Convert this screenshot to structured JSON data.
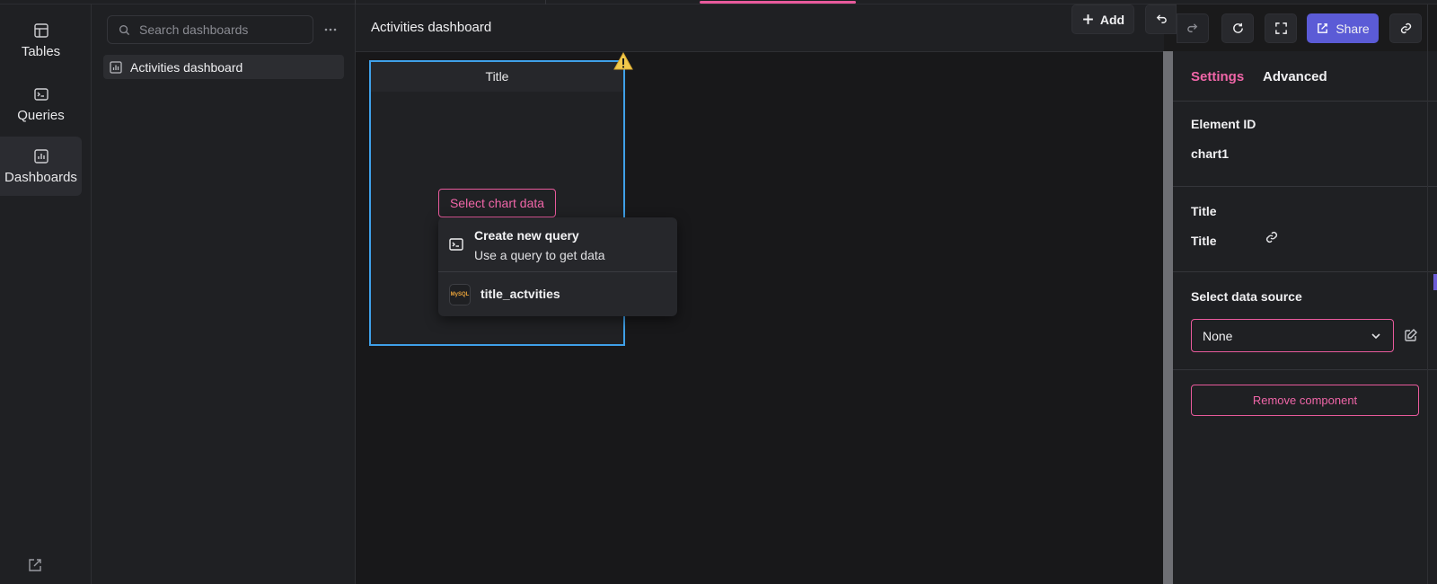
{
  "colors": {
    "accent_pink": "#e85a9c",
    "selection_blue": "#3fa0e8",
    "share_purple": "#5b5bd6",
    "warning_yellow": "#f2c94c"
  },
  "rail": {
    "items": [
      {
        "label": "Tables",
        "icon": "table-icon"
      },
      {
        "label": "Queries",
        "icon": "terminal-icon"
      },
      {
        "label": "Dashboards",
        "icon": "chart-icon"
      }
    ]
  },
  "dashboards_panel": {
    "search_placeholder": "Search dashboards",
    "items": [
      {
        "label": "Activities dashboard"
      }
    ]
  },
  "toolbar": {
    "title": "Activities dashboard",
    "add_label": "Add",
    "share_label": "Share"
  },
  "card": {
    "title": "Title",
    "select_label": "Select chart data"
  },
  "dropdown": {
    "create_title": "Create new query",
    "create_sub": "Use a query to get data",
    "query_name": "title_actvities",
    "query_icon_text": "MySQL"
  },
  "settings": {
    "tabs": [
      {
        "label": "Settings"
      },
      {
        "label": "Advanced"
      }
    ],
    "element_id_label": "Element ID",
    "element_id_value": "chart1",
    "title_label": "Title",
    "title_value": "Title",
    "data_source_label": "Select data source",
    "data_source_value": "None",
    "remove_label": "Remove component"
  }
}
